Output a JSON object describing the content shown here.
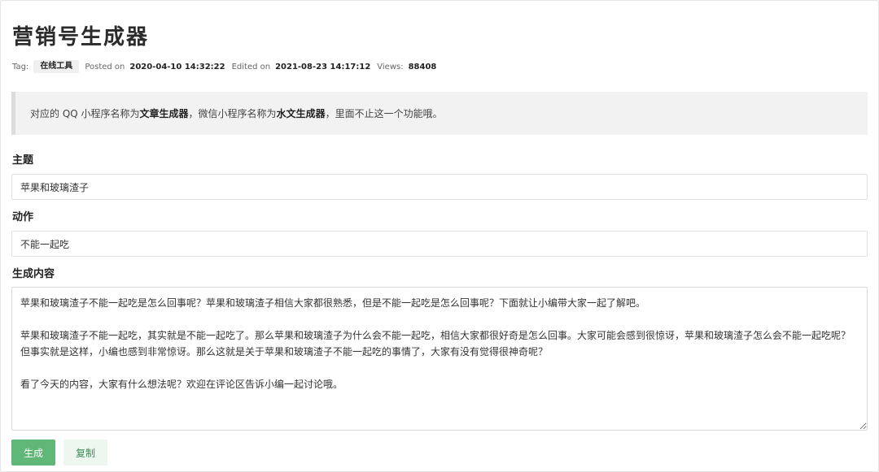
{
  "page": {
    "title": "营销号生成器"
  },
  "meta": {
    "tag_label": "Tag:",
    "tag": "在线工具",
    "posted_label": "Posted on",
    "posted": "2020-04-10 14:32:22",
    "edited_label": "Edited on",
    "edited": "2021-08-23 14:17:12",
    "views_label": "Views:",
    "views": "88408"
  },
  "notice": {
    "part1": "对应的 QQ 小程序名称为",
    "bold1": "文章生成器",
    "part2": "，微信小程序名称为",
    "bold2": "水文生成器",
    "part3": "，里面不止这一个功能哦。"
  },
  "form": {
    "subject_label": "主题",
    "subject_value": "苹果和玻璃渣子",
    "action_label": "动作",
    "action_value": "不能一起吃",
    "content_label": "生成内容",
    "content_value": "苹果和玻璃渣子不能一起吃是怎么回事呢？苹果和玻璃渣子相信大家都很熟悉，但是不能一起吃是怎么回事呢？下面就让小编带大家一起了解吧。\n\n苹果和玻璃渣子不能一起吃，其实就是不能一起吃了。那么苹果和玻璃渣子为什么会不能一起吃，相信大家都很好奇是怎么回事。大家可能会感到很惊讶，苹果和玻璃渣子怎么会不能一起吃呢？但事实就是这样，小编也感到非常惊讶。那么这就是关于苹果和玻璃渣子不能一起吃的事情了，大家有没有觉得很神奇呢？\n\n看了今天的内容，大家有什么想法呢？欢迎在评论区告诉小编一起讨论哦。"
  },
  "buttons": {
    "generate": "生成",
    "copy": "复制"
  },
  "colors": {
    "generate_bg": "#5fb878",
    "copy_bg": "#eef6f0",
    "notice_bg": "#f2f2f2"
  }
}
